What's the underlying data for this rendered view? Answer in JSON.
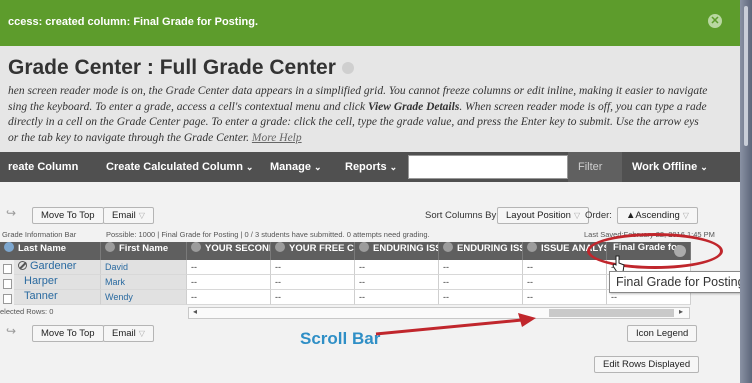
{
  "success_bar": {
    "message": "ccess: created column: Final Grade for Posting."
  },
  "header": {
    "title": "Grade Center : Full Grade Center",
    "desc_intro": "hen screen reader mode is on, the Grade Center data appears in a simplified grid. You cannot freeze columns or edit inline, making it easier to navigate sing the keyboard. To enter a grade, access a cell's contextual menu and click ",
    "desc_bold": "View Grade Details",
    "desc_rest": ". When screen reader mode is off, you can type a rade directly in a cell on the Grade Center page. To enter a grade: click the cell, type the grade value, and press the Enter key to submit. Use the arrow eys or the tab key to navigate through the Grade Center. ",
    "more_help": "More Help"
  },
  "toolbar": {
    "create_column": "reate Column",
    "create_calculated_column": "Create Calculated Column",
    "manage": "Manage",
    "reports": "Reports",
    "filter": "Filter",
    "work_offline": "Work Offline",
    "chevron": "⌄"
  },
  "actions": {
    "move_to_top": "Move To Top",
    "email": "Email",
    "sort_columns_by": "Sort Columns By:",
    "sort_value": "Layout Position",
    "order_label": "Order:",
    "order_value": "▲Ascending",
    "icon_legend": "Icon Legend",
    "edit_rows_displayed": "Edit Rows Displayed"
  },
  "info_bar": {
    "label": "Grade Information Bar",
    "text": "Possible: 1000 | Final Grade for Posting | 0 / 3 students have submitted. 0 attempts need grading.",
    "last_saved": "Last Saved:February 22, 2016 1:45 PM"
  },
  "grid": {
    "columns": [
      "Last Name",
      "First Name",
      "YOUR SECOND",
      "YOUR FREE CH",
      "ENDURING ISS",
      "ENDURING ISS",
      "ISSUE ANALYS",
      "Final Grade for"
    ],
    "rows": [
      {
        "last": "Gardener",
        "first": "David",
        "cells": [
          "--",
          "--",
          "--",
          "--",
          "--",
          "--"
        ]
      },
      {
        "last": "Harper",
        "first": "Mark",
        "cells": [
          "--",
          "--",
          "--",
          "--",
          "--",
          "--"
        ]
      },
      {
        "last": "Tanner",
        "first": "Wendy",
        "cells": [
          "--",
          "--",
          "--",
          "--",
          "--",
          "--"
        ]
      }
    ],
    "selected_rows": "elected Rows: 0"
  },
  "annotations": {
    "scroll_bar": "Scroll Bar",
    "tooltip": "Final Grade for Posting",
    "ring_color": "#c0262c",
    "label_color": "#2f8fc6"
  }
}
